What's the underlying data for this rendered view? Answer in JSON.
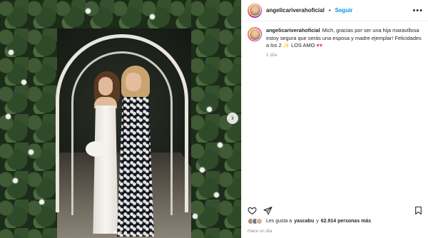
{
  "post": {
    "photo_alt": "",
    "carousel_next_glyph": "›",
    "slides": 3,
    "active_slide": 1
  },
  "header": {
    "username": "angelicariverahoficial",
    "separator": "•",
    "follow_label": "Seguir",
    "more_glyph": "•••"
  },
  "caption": {
    "username": "angelicariverahoficial",
    "text": "Mich, gracias por ser una hija maravillosa estoy segura que serás una esposa y madre ejemplar! Felicidades a los 2 ✨ LOS AMO",
    "hearts": "♥♥",
    "time": "1 día"
  },
  "actions": {
    "like_icon": "heart-icon",
    "share_icon": "share-icon",
    "save_icon": "bookmark-icon"
  },
  "likes": {
    "prefix": "Les gusta a",
    "first_user": "yascabu",
    "middle": "y",
    "count": "62.914 personas más"
  },
  "posted": "Hace un día",
  "colors": {
    "accent": "#0095f6",
    "heart": "#ed4956",
    "text": "#262626",
    "muted": "#8e8e8e"
  }
}
